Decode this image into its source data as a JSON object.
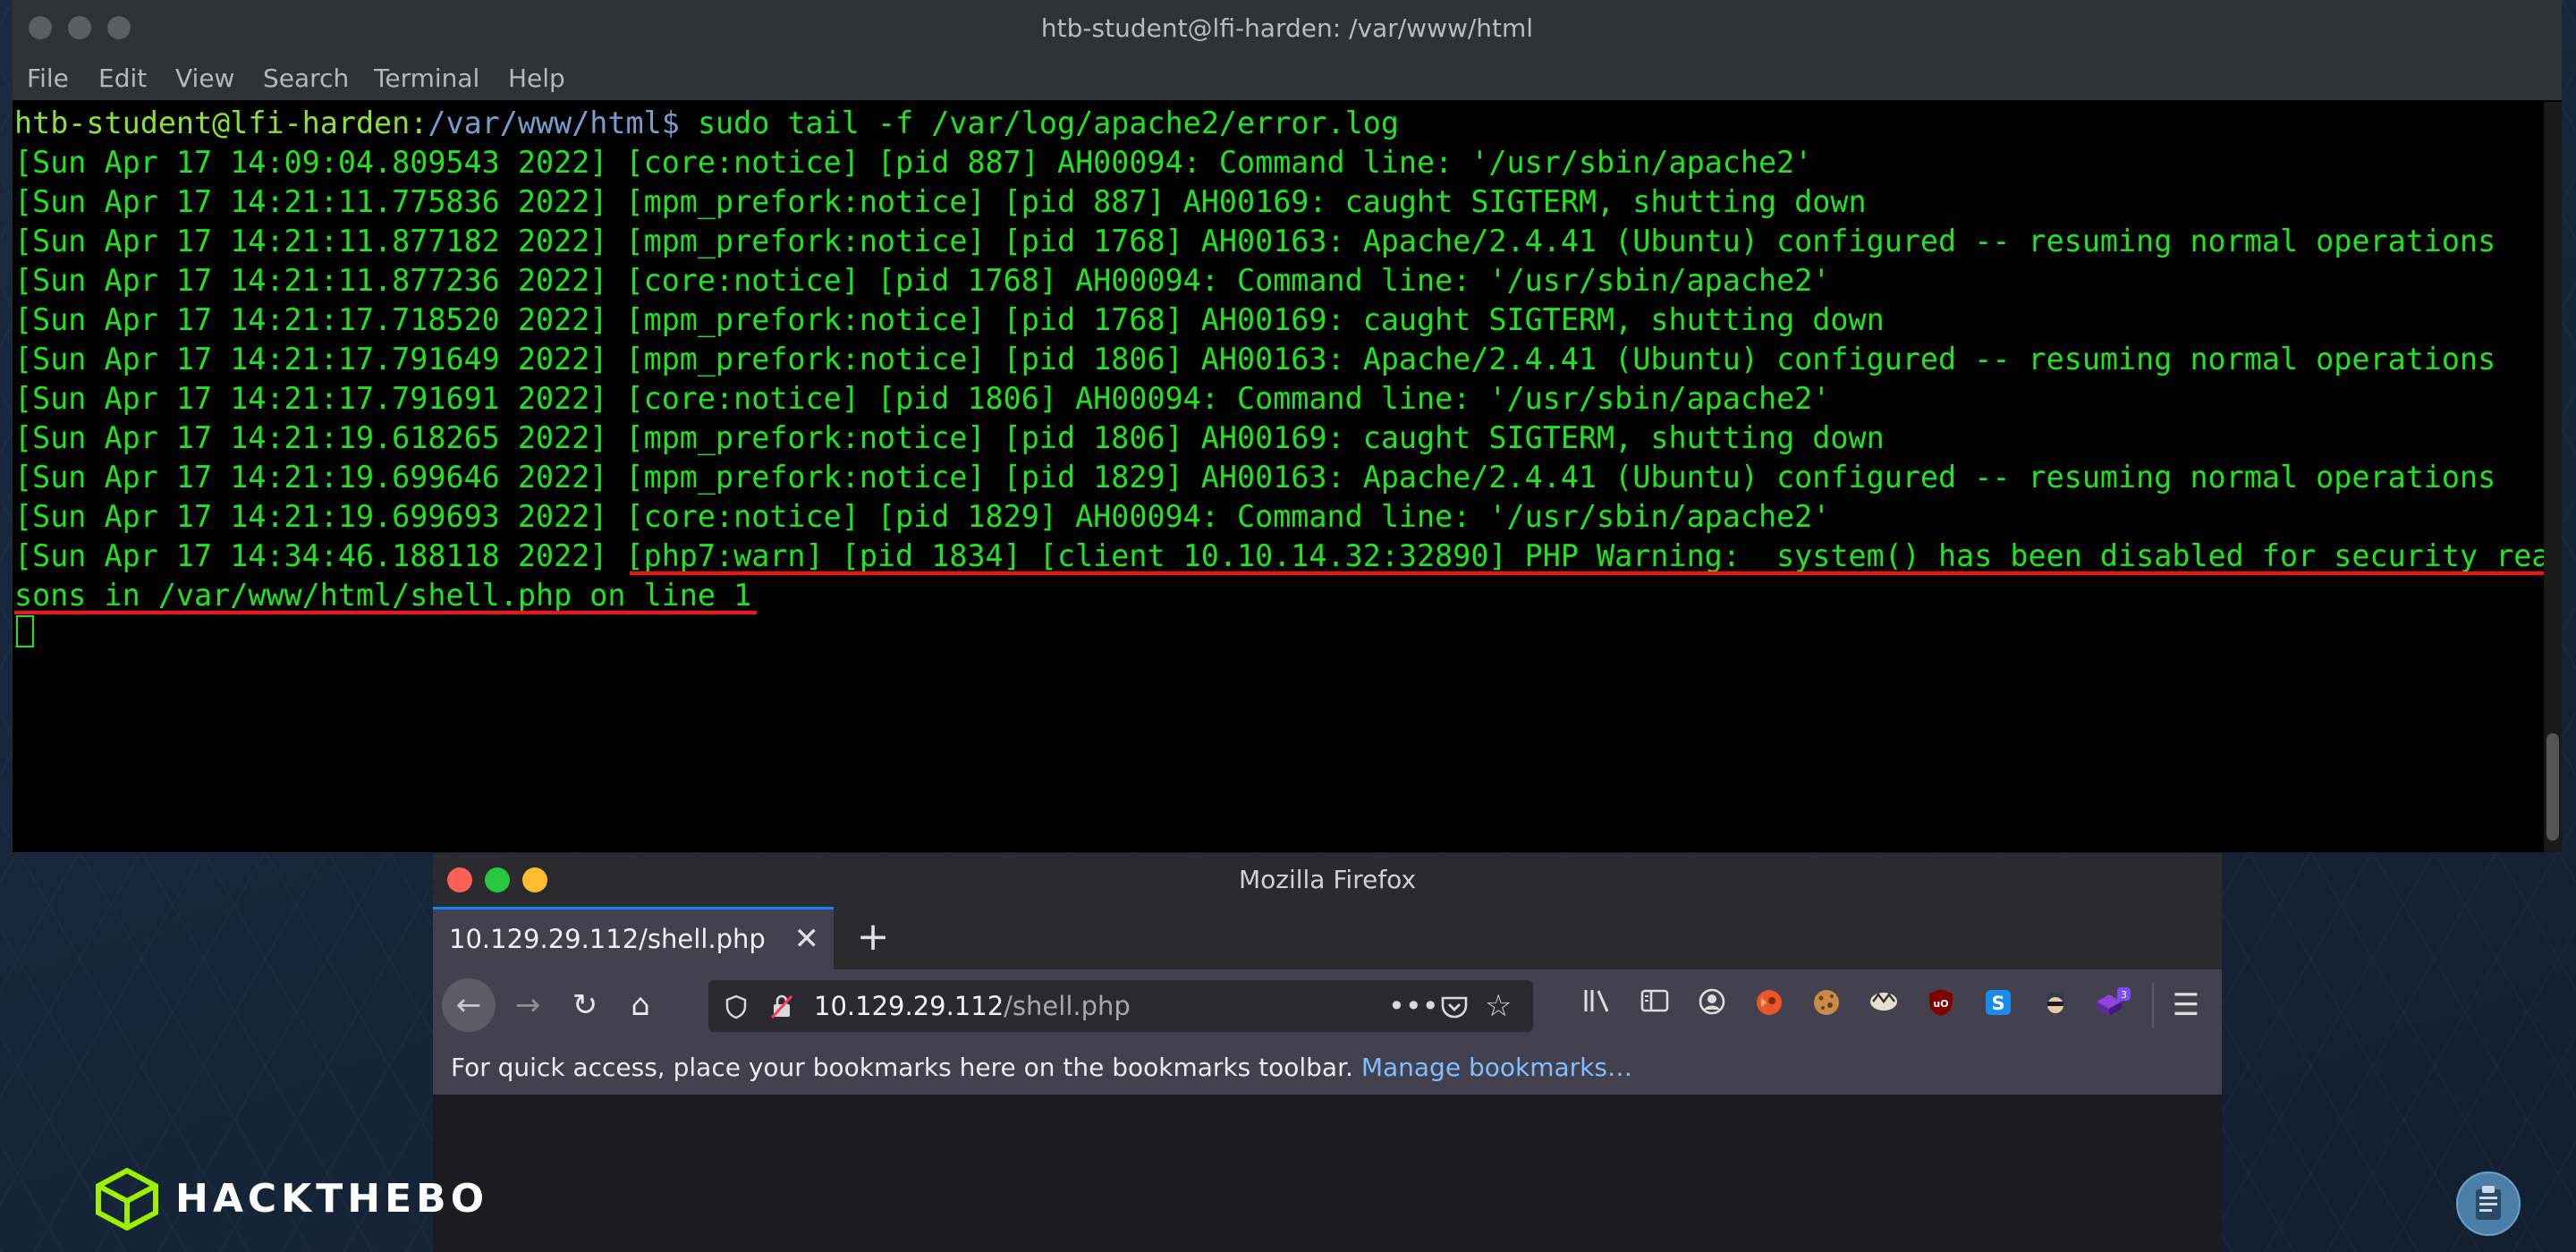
{
  "terminal": {
    "title": "htb-student@lfi-harden: /var/www/html",
    "menu": [
      "File",
      "Edit",
      "View",
      "Search",
      "Terminal",
      "Help"
    ],
    "prompt_user": "htb-student@lfi-harden",
    "prompt_sep": ":",
    "prompt_path": "/var/www/html",
    "prompt_end": "$ ",
    "command": "sudo tail -f /var/log/apache2/error.log",
    "lines": [
      "[Sun Apr 17 14:09:04.809543 2022] [core:notice] [pid 887] AH00094: Command line: '/usr/sbin/apache2'",
      "[Sun Apr 17 14:21:11.775836 2022] [mpm_prefork:notice] [pid 887] AH00169: caught SIGTERM, shutting down",
      "[Sun Apr 17 14:21:11.877182 2022] [mpm_prefork:notice] [pid 1768] AH00163: Apache/2.4.41 (Ubuntu) configured -- resuming normal operations",
      "[Sun Apr 17 14:21:11.877236 2022] [core:notice] [pid 1768] AH00094: Command line: '/usr/sbin/apache2'",
      "[Sun Apr 17 14:21:17.718520 2022] [mpm_prefork:notice] [pid 1768] AH00169: caught SIGTERM, shutting down",
      "[Sun Apr 17 14:21:17.791649 2022] [mpm_prefork:notice] [pid 1806] AH00163: Apache/2.4.41 (Ubuntu) configured -- resuming normal operations",
      "[Sun Apr 17 14:21:17.791691 2022] [core:notice] [pid 1806] AH00094: Command line: '/usr/sbin/apache2'",
      "[Sun Apr 17 14:21:19.618265 2022] [mpm_prefork:notice] [pid 1806] AH00169: caught SIGTERM, shutting down",
      "[Sun Apr 17 14:21:19.699646 2022] [mpm_prefork:notice] [pid 1829] AH00163: Apache/2.4.41 (Ubuntu) configured -- resuming normal operations",
      "[Sun Apr 17 14:21:19.699693 2022] [core:notice] [pid 1829] AH00094: Command line: '/usr/sbin/apache2'",
      "[Sun Apr 17 14:34:46.188118 2022] [php7:warn] [pid 1834] [client 10.10.14.32:32890] PHP Warning:  system() has been disabled for security rea",
      "sons in /var/www/html/shell.php on line 1"
    ],
    "text_color": "#1ee51e",
    "highlight_color": "#ff1010"
  },
  "firefox": {
    "title": "Mozilla Firefox",
    "tab_label": "10.129.29.112/shell.php",
    "url_host": "10.129.29.112",
    "url_path": "/shell.php",
    "bookmarks_text": "For quick access, place your bookmarks here on the bookmarks toolbar.",
    "bookmarks_link": "Manage bookmarks…",
    "extension_badge": "3",
    "accent": "#0a84ff"
  },
  "desktop": {
    "brand": "HACKTHEBO"
  }
}
